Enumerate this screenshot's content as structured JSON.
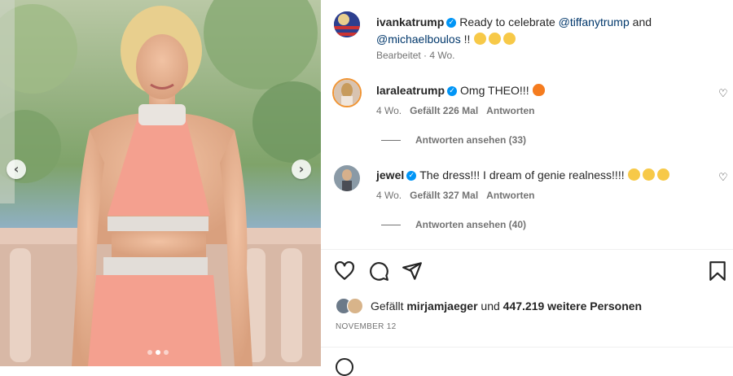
{
  "post": {
    "author": "ivankatrump",
    "caption_prefix": "Ready to celebrate ",
    "mention1": "@tiffanytrump",
    "caption_mid": " and",
    "mention2": "@michaelboulos",
    "caption_suffix": " !!",
    "edited_meta": "Bearbeitet · 4 Wo.",
    "date": "NOVEMBER 12"
  },
  "comments": [
    {
      "user": "laraleatrump",
      "text": "Omg THEO!!!",
      "age": "4 Wo.",
      "likes": "Gefällt 226 Mal",
      "reply": "Antworten",
      "view_replies": "Antworten ansehen (33)"
    },
    {
      "user": "jewel",
      "text": "The dress!!! I dream of genie realness!!!!",
      "age": "4 Wo.",
      "likes": "Gefällt 327 Mal",
      "reply": "Antworten",
      "view_replies": "Antworten ansehen (40)"
    }
  ],
  "likes_line": {
    "prefix": "Gefällt",
    "user": "mirjamjaeger",
    "mid": "und",
    "others": "447.219 weitere Personen"
  },
  "icons": {
    "heart": "heart-icon",
    "comment": "comment-icon",
    "share": "share-icon",
    "bookmark": "bookmark-icon",
    "prev": "chevron-left-icon",
    "next": "chevron-right-icon"
  },
  "colors": {
    "verified": "#0095f6",
    "mention": "#00376b",
    "dress": "#f4a08f"
  }
}
